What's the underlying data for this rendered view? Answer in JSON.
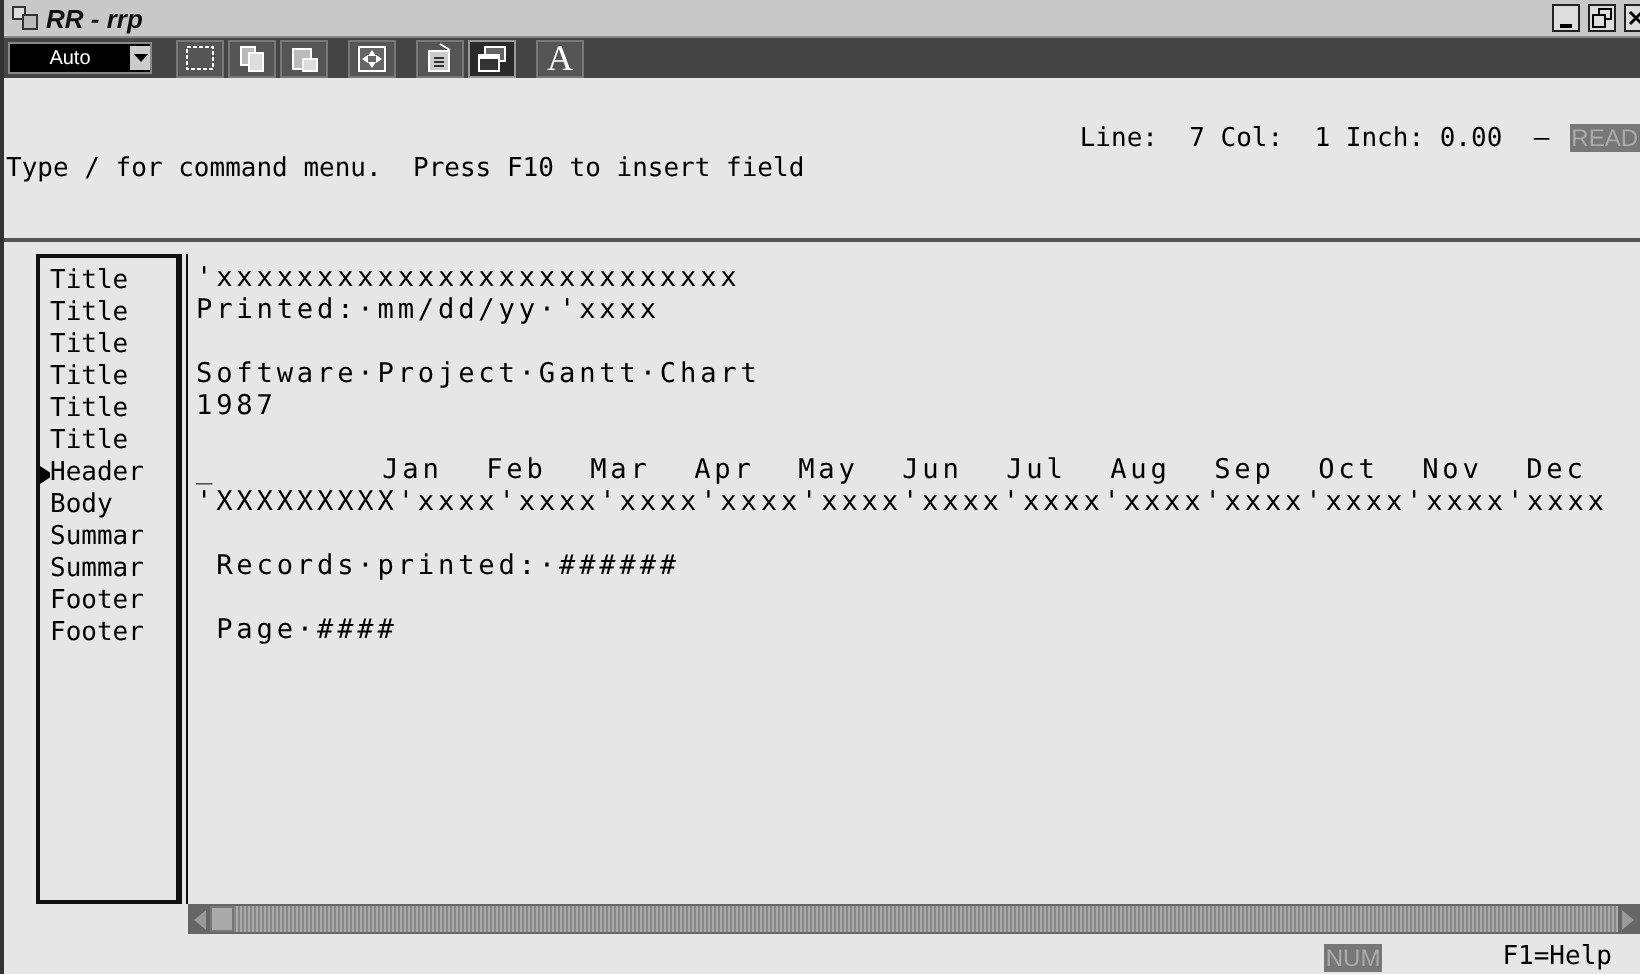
{
  "window": {
    "title": "RR - rrp"
  },
  "toolbar": {
    "style_box": {
      "value": "Auto"
    },
    "buttons": [
      {
        "kind": "select",
        "selected": false
      },
      {
        "kind": "copy",
        "selected": false
      },
      {
        "kind": "paste",
        "selected": false
      },
      {
        "kind": "move",
        "selected": false
      },
      {
        "kind": "properties",
        "selected": false
      },
      {
        "kind": "windows",
        "selected": true
      },
      {
        "kind": "font",
        "selected": false,
        "label": "A"
      }
    ]
  },
  "status_line": {
    "position": "Line:  7 Col:  1 Inch: 0.00  —",
    "mode": "READ"
  },
  "prompt": "Type / for command menu.  Press F10 to insert field",
  "bands": [
    {
      "label": "Title",
      "current": false,
      "text": "'xxxxxxxxxxxxxxxxxxxxxxxxxx"
    },
    {
      "label": "Title",
      "current": false,
      "text": "Printed:·mm/dd/yy·'xxxx"
    },
    {
      "label": "Title",
      "current": false
    },
    {
      "label": "Title",
      "current": false,
      "text": "Software·Project·Gantt·Chart"
    },
    {
      "label": "Title",
      "current": false,
      "text": "1987"
    },
    {
      "label": "Title",
      "current": false
    },
    {
      "label": "Header",
      "current": true,
      "cursor": "_",
      "months": [
        "Jan",
        "Feb",
        "Mar",
        "Apr",
        "May",
        "Jun",
        "Jul",
        "Aug",
        "Sep",
        "Oct",
        "Nov",
        "Dec"
      ]
    },
    {
      "label": "Body",
      "current": false,
      "text": "'XXXXXXXXX'xxxx'xxxx'xxxx'xxxx'xxxx'xxxx'xxxx'xxxx'xxxx'xxxx'xxxx'xxxx"
    },
    {
      "label": "Summar",
      "current": false
    },
    {
      "label": "Summar",
      "current": false,
      "text": " Records·printed:·*######*"
    },
    {
      "label": "Footer",
      "current": false
    },
    {
      "label": "Footer",
      "current": false,
      "text": " Page·*####*"
    }
  ],
  "status_bar": {
    "indicator": "NUM",
    "help": "F1=Help"
  }
}
